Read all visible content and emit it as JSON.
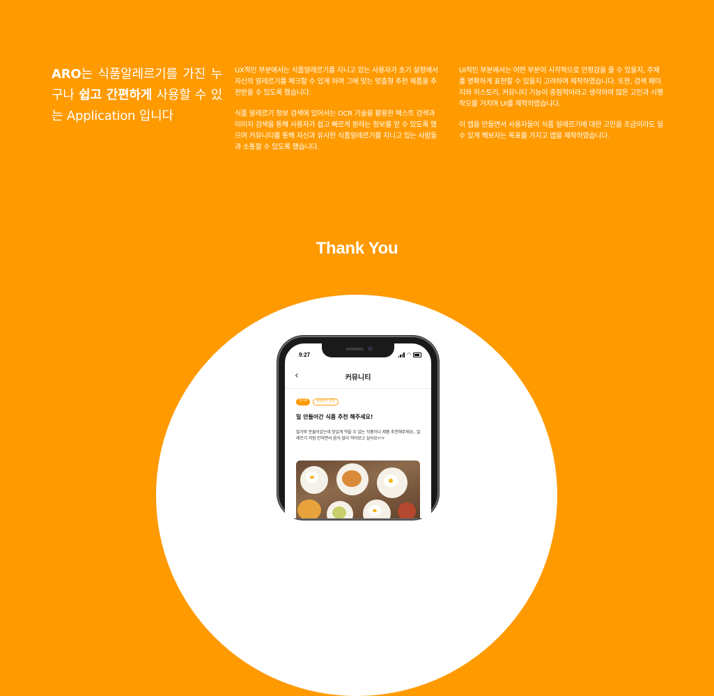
{
  "intro": {
    "brand": "ARO",
    "part1": "는 식품알레르기를 가진 누구나 ",
    "emphasis": "쉽고 간편하게",
    "part2": " 사용할 수 있는 Application 입니다"
  },
  "ux_column": {
    "p1": "UX적인 부분에서는 식품알레르기를 지니고 있는 사용자가 초기 설정에서 자신의 알레르기를 체크할 수 있게 하며 그에 맞는 맞춤형 추천 제품을 추천받을 수 있도록 했습니다.",
    "p2": "식품 알레르기 정보 검색에 있어서는 OCR 기술을 활용한 텍스트 검색과 이미지 검색을 통해 사용자가 쉽고 빠르게 원하는 정보를 얻 수 있도록 했으며 커뮤니티를 통해 자신과 유사한 식품알레르기를 지니고 있는 사람들과 소통할 수 있도록 했습니다."
  },
  "ui_column": {
    "p1": "UI적인 부분에서는 어떤 부분이 시각적으로 안정감을 줄 수 있을지, 주제를 명확하게 표현할 수 있을지 고려하며 제작하였습니다. 또한, 검색 페이지와 히스토리, 커뮤니티 기능이 중점적이라고 생각하여 많은 고민과 시행착오를 거치며 UI를 제작하였습니다.",
    "p2": "이 앱을 만들면서 사용자들이 식품 알레르기에 대한 고민을 조금이라도 덜 수 있게 해보자는 목표를 가지고 앱을 제작하였습니다."
  },
  "thanks": "Thank You",
  "phone": {
    "time": "9:27",
    "nav_title": "커뮤니티",
    "back_glyph": "‹",
    "tags": [
      "밀가루",
      "알레르기 조치"
    ],
    "post_title": "밀 안들어간 식품 추천 해주세요!",
    "post_body": "밀가루 안들어갔는데 맛있게 먹을 수 있는 식품이나 제품 추천해주세요.. 알레르기 걱정 안하면서 음식 많이 먹어보고 싶어요ㅠㅠ"
  },
  "colors": {
    "accent": "#FF9A00",
    "background": "#FF9A00",
    "circle": "#FFFFFF"
  }
}
